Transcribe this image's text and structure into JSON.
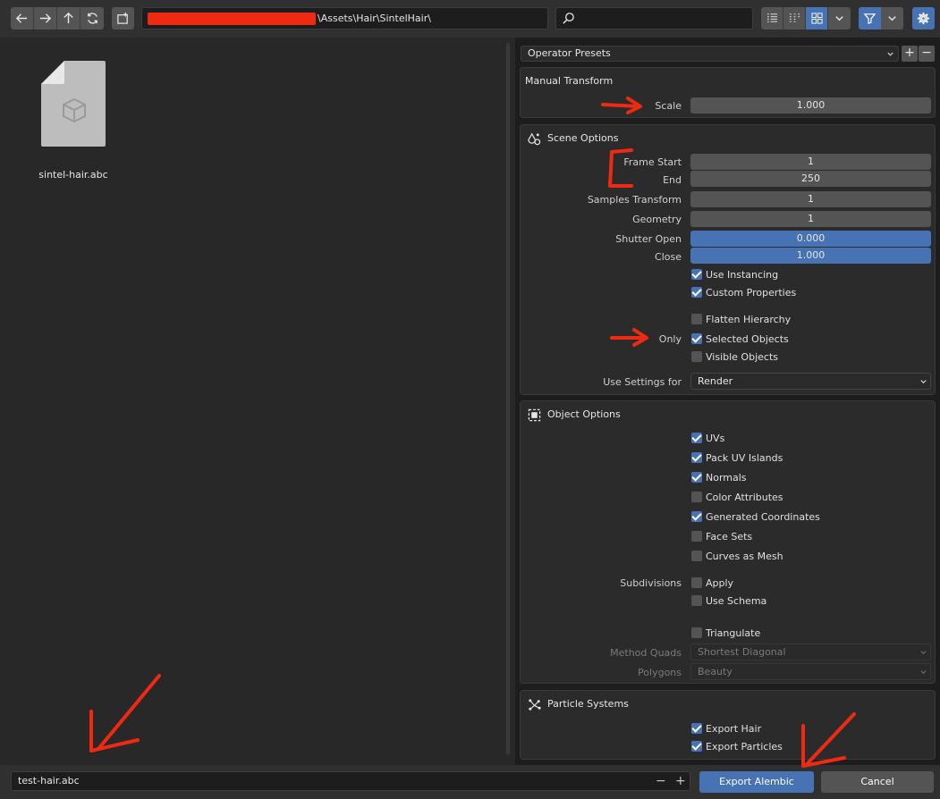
{
  "toolbar": {
    "path_suffix": "\\Assets\\Hair\\SintelHair\\",
    "nav_icons": [
      "back-icon",
      "forward-icon",
      "parent-directory-icon",
      "refresh-icon"
    ],
    "new_folder_icon": "new-folder-icon",
    "search_icon": "search-icon",
    "search_value": "",
    "view_modes": [
      "vertical-list-icon",
      "horizontal-list-icon",
      "thumbnails-icon"
    ],
    "active_view": "thumbnails",
    "filter_icon": "filter-icon",
    "settings_icon": "gear-icon"
  },
  "files": [
    {
      "name": "sintel-hair.abc",
      "icon": "file-3d-icon"
    }
  ],
  "sidebar": {
    "operator_presets": "Operator Presets",
    "manual_transform": {
      "title": "Manual Transform",
      "scale_label": "Scale",
      "scale_value": "1.000"
    },
    "scene_options": {
      "title": "Scene Options",
      "frame_start_label": "Frame Start",
      "frame_start_value": "1",
      "end_label": "End",
      "end_value": "250",
      "samples_transform_label": "Samples Transform",
      "samples_transform_value": "1",
      "geometry_label": "Geometry",
      "geometry_value": "1",
      "shutter_open_label": "Shutter Open",
      "shutter_open_value": "0.000",
      "close_label": "Close",
      "close_value": "1.000",
      "use_instancing": {
        "label": "Use Instancing",
        "checked": true
      },
      "custom_properties": {
        "label": "Custom Properties",
        "checked": true
      },
      "flatten_hierarchy": {
        "label": "Flatten Hierarchy",
        "checked": false
      },
      "only_label": "Only",
      "selected_objects": {
        "label": "Selected Objects",
        "checked": true
      },
      "visible_objects": {
        "label": "Visible Objects",
        "checked": false
      },
      "use_settings_label": "Use Settings for",
      "use_settings_value": "Render"
    },
    "object_options": {
      "title": "Object Options",
      "uvs": {
        "label": "UVs",
        "checked": true
      },
      "pack_uv": {
        "label": "Pack UV Islands",
        "checked": true
      },
      "normals": {
        "label": "Normals",
        "checked": true
      },
      "color_attributes": {
        "label": "Color Attributes",
        "checked": false
      },
      "generated_coordinates": {
        "label": "Generated Coordinates",
        "checked": true
      },
      "face_sets": {
        "label": "Face Sets",
        "checked": false
      },
      "curves_as_mesh": {
        "label": "Curves as Mesh",
        "checked": false
      },
      "subdivisions_label": "Subdivisions",
      "apply": {
        "label": "Apply",
        "checked": false
      },
      "use_schema": {
        "label": "Use Schema",
        "checked": false
      },
      "triangulate": {
        "label": "Triangulate",
        "checked": false
      },
      "method_quads_label": "Method Quads",
      "method_quads_value": "Shortest Diagonal",
      "polygons_label": "Polygons",
      "polygons_value": "Beauty"
    },
    "particle_systems": {
      "title": "Particle Systems",
      "export_hair": {
        "label": "Export Hair",
        "checked": true
      },
      "export_particles": {
        "label": "Export Particles",
        "checked": true
      }
    }
  },
  "bottom": {
    "filename": "test-hair.abc",
    "minus": "−",
    "plus": "+",
    "export_label": "Export Alembic",
    "cancel_label": "Cancel"
  },
  "colors": {
    "accent": "#4772b3",
    "annotation": "#ee2a12"
  }
}
